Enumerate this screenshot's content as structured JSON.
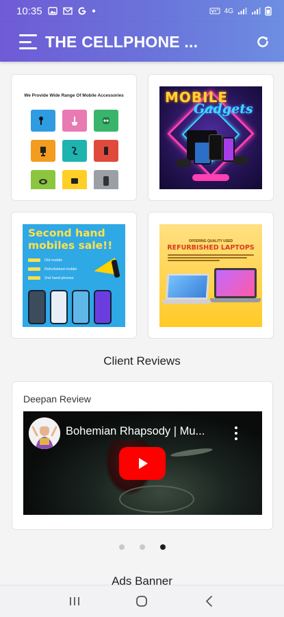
{
  "status_bar": {
    "time": "10:35",
    "network": "4G",
    "icons": [
      "gallery-icon",
      "mail-icon",
      "g-logo-icon",
      "dot-icon",
      "vowifi-icon",
      "signal-icon",
      "signal-icon",
      "battery-icon"
    ]
  },
  "app_bar": {
    "title": "THE CELLPHONE ...",
    "menu_icon": "hamburger-menu-icon",
    "refresh_icon": "refresh-icon"
  },
  "promos": {
    "accessories": {
      "title": "We Provide Wide Range Of Mobile Accessories",
      "tile_colors": [
        "#2f9be0",
        "#e87ab4",
        "#38b56a",
        "#f39c1f",
        "#1fb3b0",
        "#e04a3c",
        "#8cc63f",
        "#ffcf26",
        "#9aa0a6"
      ]
    },
    "gadgets": {
      "word1": "MOBILE",
      "word2": "Gadgets"
    },
    "second_hand": {
      "headline": "Second hand mobiles sale!!",
      "items": [
        "Old mobile",
        "Refurbished mobile",
        "2nd hand phones"
      ]
    },
    "laptops": {
      "subtitle": "OFFERING QUALITY USED",
      "headline": "REFURBISHED LAPTOPS"
    }
  },
  "reviews": {
    "section_title": "Client Reviews",
    "card": {
      "reviewer": "Deepan Review",
      "video_title": "Bohemian Rhapsody | Mu..."
    },
    "carousel": {
      "count": 3,
      "active_index": 2
    }
  },
  "ads": {
    "section_title": "Ads Banner"
  },
  "nav_bar": {
    "icons": [
      "recents-icon",
      "home-icon",
      "back-icon"
    ]
  },
  "colors": {
    "app_bar_gradient_start": "#6f5bd6",
    "app_bar_gradient_end": "#6d8ee2",
    "youtube_red": "#ff0000"
  }
}
